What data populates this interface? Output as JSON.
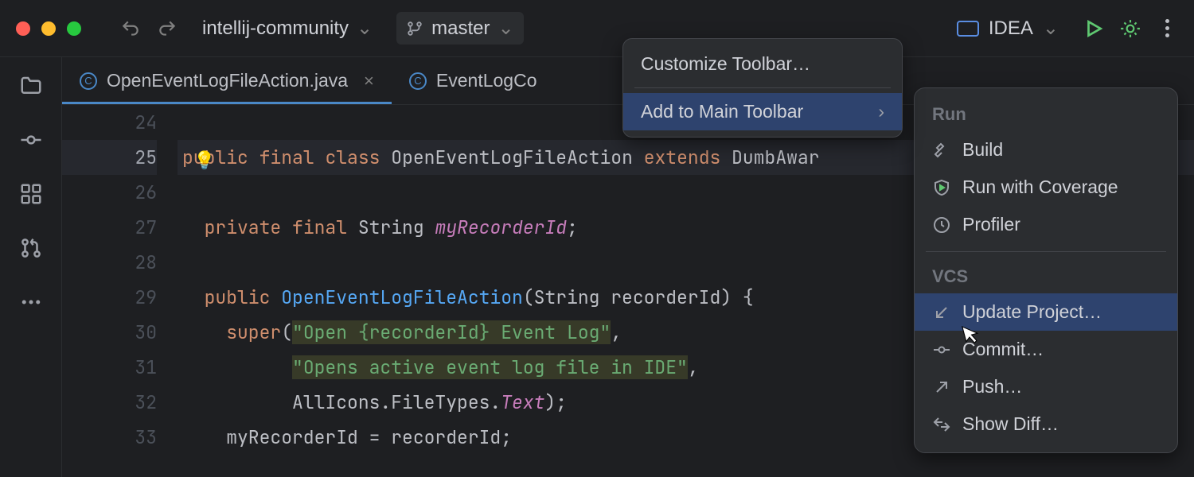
{
  "toolbar": {
    "project_name": "intellij-community",
    "branch_name": "master",
    "run_config": "IDEA"
  },
  "tabs": [
    {
      "name": "OpenEventLogFileAction.java",
      "active": true
    },
    {
      "name": "EventLogCo",
      "active": false
    }
  ],
  "gutter": [
    "24",
    "25",
    "26",
    "27",
    "28",
    "29",
    "30",
    "31",
    "32",
    "33"
  ],
  "context_menu": {
    "item1": "Customize Toolbar…",
    "item2": "Add to Main Toolbar"
  },
  "action_panel": {
    "section1": "Run",
    "items1": [
      "Build",
      "Run with Coverage",
      "Profiler"
    ],
    "section2": "VCS",
    "items2": [
      "Update Project…",
      "Commit…",
      "Push…",
      "Show Diff…"
    ]
  },
  "code": {
    "l25_kw1": "public",
    "l25_kw2": "final",
    "l25_kw3": "class",
    "l25_cls": "OpenEventLogFileAction",
    "l25_kw4": "extends",
    "l25_sup": "DumbAwar",
    "l27_kw1": "private",
    "l27_kw2": "final",
    "l27_type": "String",
    "l27_field": "myRecorderId",
    "l27_end": ";",
    "l29_kw": "public",
    "l29_ctor": "OpenEventLogFileAction",
    "l29_sig": "(String recorderId) {",
    "l30_call": "super",
    "l30_open": "(",
    "l30_str": "\"Open {recorderId} Event Log\"",
    "l30_end": ",",
    "l31_str": "\"Opens active event log file in IDE\"",
    "l31_end": ",",
    "l32_pre": "AllIcons.FileTypes.",
    "l32_mem": "Text",
    "l32_end": ");",
    "l33_lhs": "myRecorderId",
    "l33_mid": " = recorderId;"
  }
}
